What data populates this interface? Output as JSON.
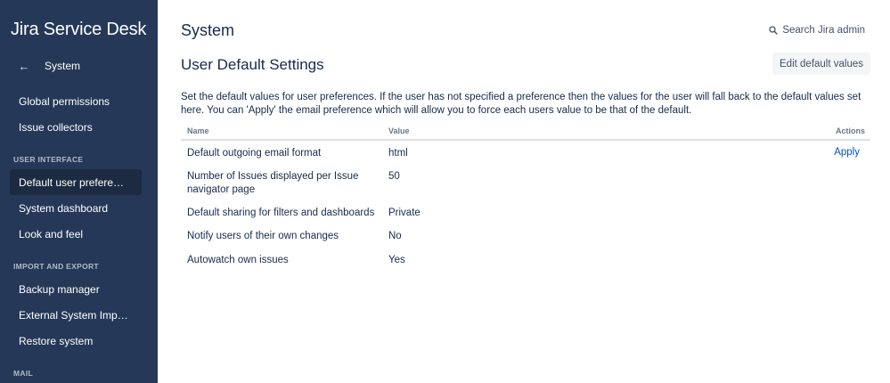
{
  "sidebar": {
    "brand": "Jira Service Desk",
    "back_label": "System",
    "items": [
      {
        "label": "Global permissions",
        "selected": false
      },
      {
        "label": "Issue collectors",
        "selected": false
      },
      {
        "label": "Default user prefere…",
        "selected": true
      },
      {
        "label": "System dashboard",
        "selected": false
      },
      {
        "label": "Look and feel",
        "selected": false
      },
      {
        "label": "Backup manager",
        "selected": false
      },
      {
        "label": "External System Imp…",
        "selected": false
      },
      {
        "label": "Restore system",
        "selected": false
      }
    ],
    "sections": {
      "user_interface": "USER INTERFACE",
      "import_export": "IMPORT AND EXPORT",
      "mail": "MAIL"
    }
  },
  "header": {
    "title": "System",
    "search_label": "Search Jira admin"
  },
  "main": {
    "section_title": "User Default Settings",
    "edit_button_label": "Edit default values",
    "description": "Set the default values for user preferences. If the user has not specified a preference then the values for the user will fall back to the default values set here. You can 'Apply' the email preference which will allow you to force each users value to be that of the default.",
    "table": {
      "columns": {
        "name": "Name",
        "value": "Value",
        "actions": "Actions"
      },
      "rows": [
        {
          "name": "Default outgoing email format",
          "value": "html",
          "action": "Apply"
        },
        {
          "name": "Number of Issues displayed per Issue navigator page",
          "value": "50",
          "action": ""
        },
        {
          "name": "Default sharing for filters and dashboards",
          "value": "Private",
          "action": ""
        },
        {
          "name": "Notify users of their own changes",
          "value": "No",
          "action": ""
        },
        {
          "name": "Autowatch own issues",
          "value": "Yes",
          "action": ""
        }
      ]
    }
  },
  "colors": {
    "sidebar_bg": "#253858",
    "sidebar_selected": "#1c2b42",
    "link": "#0052cc",
    "text": "#172b4d"
  }
}
